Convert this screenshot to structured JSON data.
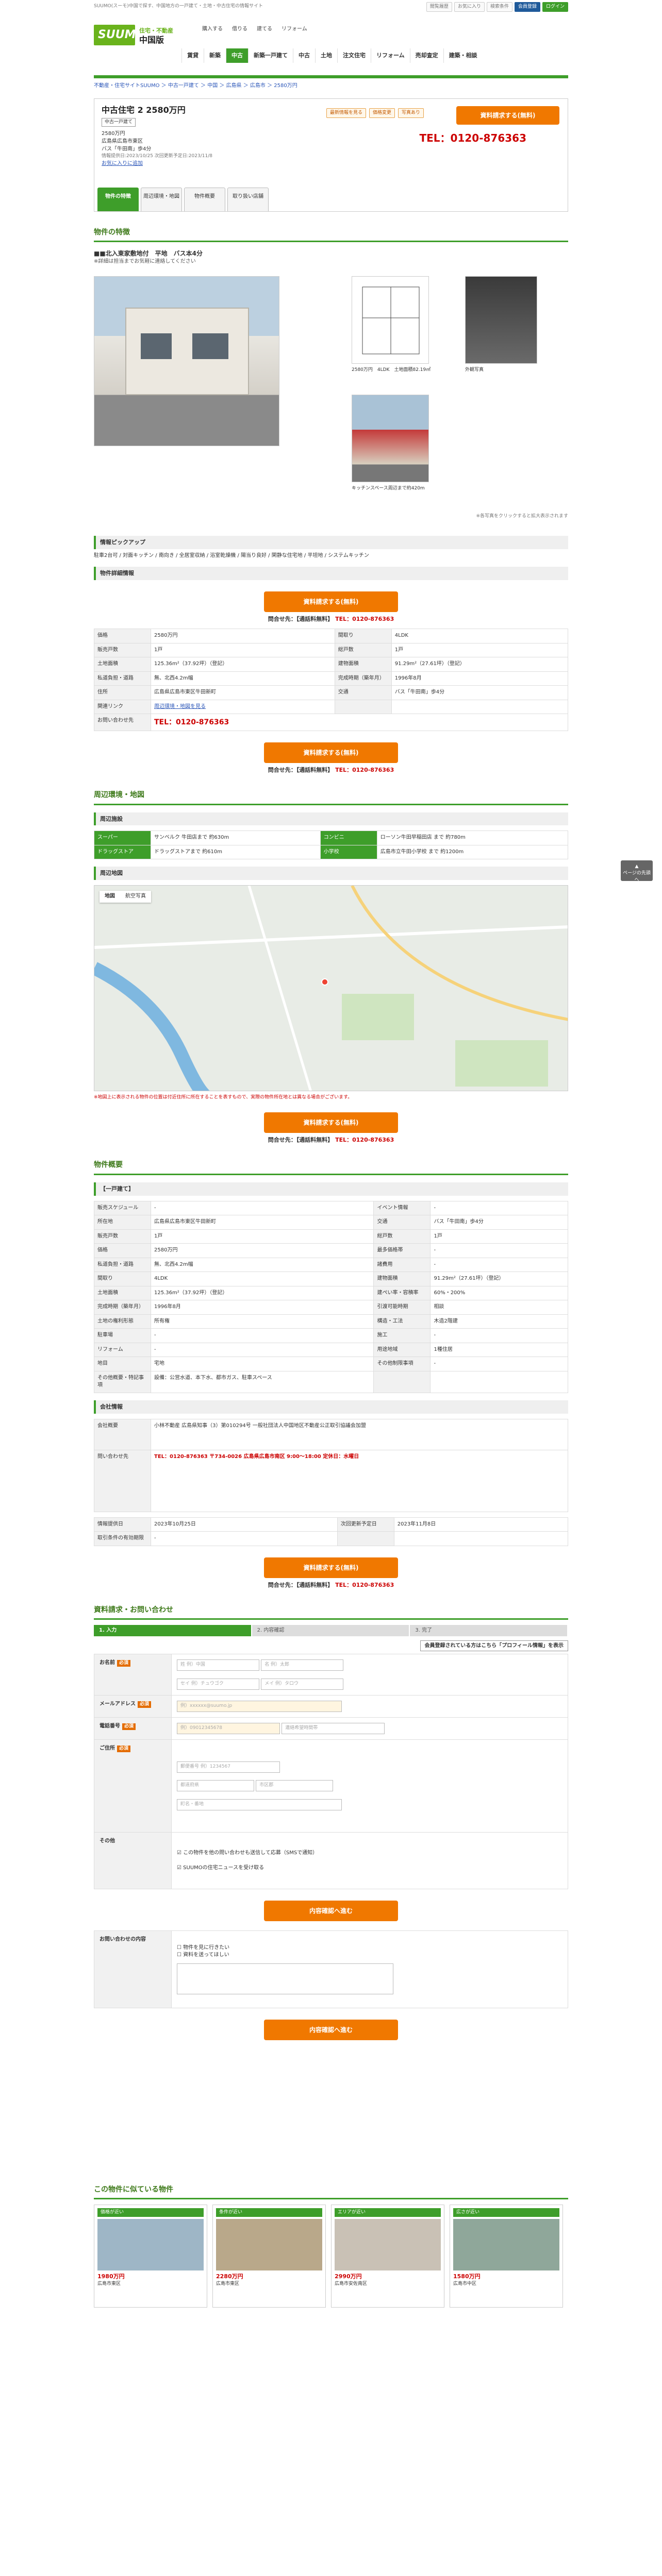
{
  "topbar": {
    "tagline": "SUUMO(スーモ)中国で探す、中国地方の一戸建て・土地・中古住宅の情報サイト",
    "links": [
      "閲覧履歴",
      "お気に入り",
      "検索条件"
    ],
    "login_label": "ログイン",
    "register_label": "会員登録"
  },
  "header": {
    "logo": "SUUMO",
    "logo_sub": "住宅・不動産",
    "region": "中国版",
    "top_links": [
      "購入する",
      "借りる",
      "建てる",
      "リフォーム"
    ],
    "nav": [
      "賃貸",
      "新築",
      "中古",
      "新築一戸建て",
      "中古",
      "土地",
      "注文住宅",
      "リフォーム",
      "売却査定",
      "建築・相談"
    ],
    "nav_active": 2
  },
  "breadcrumb": "不動産・住宅サイトSUUMO ＞ 中古一戸建て ＞ 中国 ＞ 広島県 ＞ 広島市 ＞ 2580万円",
  "property": {
    "title": "中古住宅 2 2580万円",
    "tag": "中古一戸建て",
    "price": "2580万円",
    "address": "広島県広島市東区",
    "access": "バス「牛田南」歩4分",
    "info_note": "情報提供日:2023/10/25 次回更新予定日:2023/11/8",
    "link_label": "お気に入りに追加",
    "badges": [
      "最新情報を見る",
      "価格変更",
      "写真あり"
    ],
    "request_label": "資料請求する(無料)",
    "tel": "TEL：0120-876363",
    "tabs": [
      "物件の特徴",
      "周辺環境・地図",
      "物件概要",
      "取り扱い店舗"
    ]
  },
  "features": {
    "heading": "物件の特徴",
    "title": "■■北入東家敷地付　平地　バス本4分",
    "sub": "※詳細は担当までお気軽に連絡してください",
    "photo_caps": [
      "2580万円　4LDK　土地面積82.19㎡",
      "外観写真",
      "キッチンスペース周辺まで約420m"
    ],
    "note": "※各写真をクリックすると拡大表示されます"
  },
  "pickup": {
    "heading": "情報ピックアップ",
    "text": "駐車2台可 / 対面キッチン / 南向き / 全居室収納 / 浴室乾燥機 / 陽当り良好 / 閑静な住宅地 / 平坦地 / システムキッチン"
  },
  "detail": {
    "heading": "物件詳細情報",
    "cta": "資料請求する(無料)",
    "tel_label": "問合せ先：【通話料無料】",
    "tel_number": "TEL：0120-876363",
    "rows": [
      [
        "価格",
        "2580万円",
        "間取り",
        "4LDK"
      ],
      [
        "販売戸数",
        "1戸",
        "総戸数",
        "1戸"
      ],
      [
        "土地面積",
        "125.36m²（37.92坪）（登記）",
        "建物面積",
        "91.29m²（27.61坪）（登記）"
      ],
      [
        "私道負担・道路",
        "無、北西4.2m幅",
        "完成時期（築年月）",
        "1996年8月"
      ],
      [
        "住所",
        "広島県広島市東区牛田新町",
        "交通",
        "バス「牛田南」歩4分"
      ],
      [
        "関連リンク",
        "周辺環境・地図を見る",
        "",
        ""
      ]
    ],
    "contact_label": "お問い合わせ先",
    "contact_tel": "TEL：0120-876363"
  },
  "area": {
    "heading": "周辺環境・地図",
    "sub_heading": "周辺施設",
    "facilities": [
      [
        "スーパー",
        "サンベルク 牛田店まで 約630m"
      ],
      [
        "コンビニ",
        "ローソン牛田早稲田店 まで 約780m"
      ],
      [
        "ドラッグストア",
        "ドラッグストアまで 約610m"
      ],
      [
        "小学校",
        "広島市立牛田小学校 まで 約1200m"
      ]
    ],
    "map_heading": "周辺地図",
    "map_tabs": [
      "地図",
      "航空写真"
    ],
    "notes": "※地図上に表示される物件の位置は付近住所に所在することを表すもので、実際の物件所在地とは異なる場合がございます。"
  },
  "overview": {
    "heading": "物件概要",
    "sub_heading": "【一戸建て】",
    "rows": [
      [
        "販売スケジュール",
        "-",
        "イベント情報",
        "-"
      ],
      [
        "所在地",
        "広島県広島市東区牛田新町",
        "交通",
        "バス「牛田南」歩4分"
      ],
      [
        "販売戸数",
        "1戸",
        "総戸数",
        "1戸"
      ],
      [
        "価格",
        "2580万円",
        "最多価格帯",
        "-"
      ],
      [
        "私道負担・道路",
        "無、北西4.2m幅",
        "諸費用",
        "-"
      ],
      [
        "間取り",
        "4LDK",
        "建物面積",
        "91.29m²（27.61坪）（登記）"
      ],
      [
        "土地面積",
        "125.36m²（37.92坪）（登記）",
        "建ぺい率・容積率",
        "60%・200%"
      ],
      [
        "完成時期（築年月）",
        "1996年8月",
        "引渡可能時期",
        "相談"
      ],
      [
        "土地の権利形態",
        "所有権",
        "構造・工法",
        "木造2階建"
      ],
      [
        "駐車場",
        "-",
        "施工",
        "-"
      ],
      [
        "リフォーム",
        "-",
        "用途地域",
        "1種住居"
      ],
      [
        "地目",
        "宅地",
        "その他制限事項",
        "-"
      ],
      [
        "その他概要・特記事項",
        "設備：公営水道、本下水、都市ガス、駐車スペース",
        "",
        ""
      ]
    ],
    "company_heading": "会社情報",
    "company_rows": [
      [
        "会社概要",
        "小林不動産 広島県知事（3）第010294号 一般社団法人中国地区不動産公正取引協議会加盟"
      ],
      [
        "問い合わせ先",
        "TEL：0120-876363 〒734-0026 広島県広島市南区 9:00〜18:00 定休日：水曜日"
      ]
    ],
    "info_rows": [
      [
        "情報提供日",
        "2023年10月25日",
        "次回更新予定日",
        "2023年11月8日"
      ],
      [
        "取引条件の有効期限",
        "-",
        "",
        ""
      ]
    ]
  },
  "form": {
    "heading": "資料請求・お問い合わせ",
    "steps": [
      "1. 入力",
      "2. 内容確認",
      "3. 完了"
    ],
    "login_label": "会員登録されている方はこちら「プロフィール情報」を表示",
    "rows": [
      {
        "label": "お名前",
        "fields": [
          "姓 例）中国",
          "名 例）太郎",
          "セイ 例）チュウゴク",
          "メイ 例）タロウ"
        ]
      },
      {
        "label": "メールアドレス",
        "fields": [
          "例）xxxxxx@suumo.jp"
        ]
      },
      {
        "label": "電話番号",
        "fields": [
          "例）09012345678",
          "連絡希望時間帯"
        ]
      },
      {
        "label": "ご住所",
        "fields": [
          "郵便番号 例）1234567",
          "都道府県",
          "市区郡",
          "町名・番地"
        ]
      },
      {
        "label": "その他",
        "fields": [
          "この物件を他の問い合わせも送信して応募（SMSで通知）",
          "SUUMOの住宅ニュースを受け取る"
        ]
      }
    ],
    "submit": "内容確認へ進む",
    "inquiry_label": "お問い合わせの内容",
    "inquiry_options": [
      "物件を見に行きたい",
      "資料を送ってほしい"
    ],
    "submit2": "内容確認へ進む"
  },
  "recommend": {
    "heading": "この物件に似ている物件",
    "cards": [
      {
        "label": "価格が近い",
        "price": "1980万円",
        "area": "広島市東区"
      },
      {
        "label": "条件が近い",
        "price": "2280万円",
        "area": "広島市東区"
      },
      {
        "label": "エリアが近い",
        "price": "2990万円",
        "area": "広島市安佐南区"
      },
      {
        "label": "広さが近い",
        "price": "1580万円",
        "area": "広島市中区"
      }
    ]
  },
  "pagetop": "ページの先頭へ"
}
